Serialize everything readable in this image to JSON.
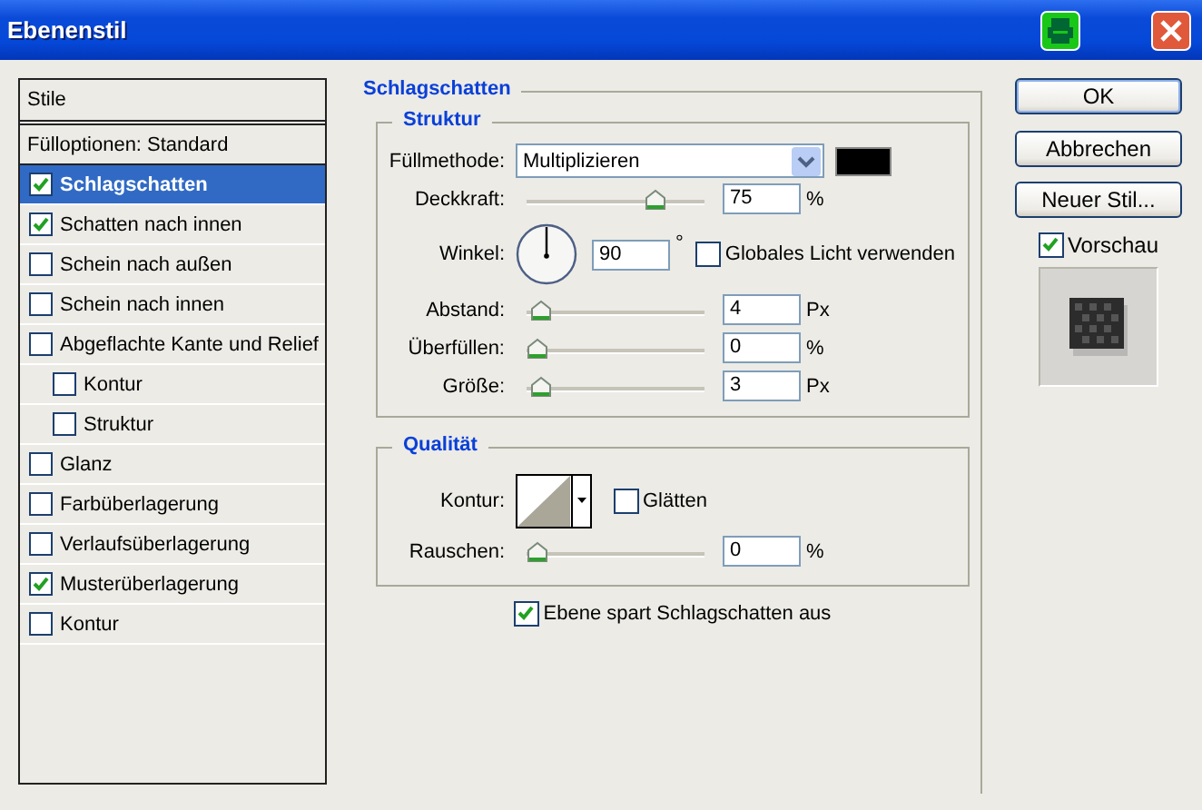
{
  "window": {
    "title": "Ebenenstil"
  },
  "styles_panel": {
    "header": "Stile",
    "items": [
      {
        "kind": "plain",
        "label": "Fülloptionen: Standard",
        "selected": false
      },
      {
        "kind": "check",
        "label": "Schlagschatten",
        "checked": true,
        "selected": true
      },
      {
        "kind": "check",
        "label": "Schatten nach innen",
        "checked": true,
        "selected": false
      },
      {
        "kind": "check",
        "label": "Schein nach außen",
        "checked": false,
        "selected": false
      },
      {
        "kind": "check",
        "label": "Schein nach innen",
        "checked": false,
        "selected": false
      },
      {
        "kind": "check",
        "label": "Abgeflachte Kante und Relief",
        "checked": false,
        "selected": false,
        "children": [
          {
            "label": "Kontur",
            "checked": false,
            "selected": false
          },
          {
            "label": "Struktur",
            "checked": false,
            "selected": false
          }
        ]
      },
      {
        "kind": "check",
        "label": "Glanz",
        "checked": false,
        "selected": false
      },
      {
        "kind": "check",
        "label": "Farbüberlagerung",
        "checked": false,
        "selected": false
      },
      {
        "kind": "check",
        "label": "Verlaufsüberlagerung",
        "checked": false,
        "selected": false
      },
      {
        "kind": "check",
        "label": "Musterüberlagerung",
        "checked": true,
        "selected": false
      },
      {
        "kind": "check",
        "label": "Kontur",
        "checked": false,
        "selected": false
      }
    ]
  },
  "section": {
    "title": "Schlagschatten",
    "structure": {
      "title": "Struktur",
      "blend_mode": {
        "label": "Füllmethode:",
        "value": "Multiplizieren",
        "color": "#000000"
      },
      "rows": [
        {
          "kind": "slider",
          "label": "Deckkraft:",
          "level": 0.75,
          "value": "75",
          "unit": "%"
        },
        {
          "kind": "angle",
          "label": "Winkel:",
          "value": "90",
          "unit": "°",
          "global_light": {
            "label": "Globales Licht verwenden",
            "checked": false
          }
        },
        {
          "kind": "slider",
          "label": "Abstand:",
          "level": 0.02,
          "value": "4",
          "unit": "Px"
        },
        {
          "kind": "slider",
          "label": "Überfüllen:",
          "level": 0,
          "value": "0",
          "unit": "%"
        },
        {
          "kind": "slider",
          "label": "Größe:",
          "level": 0.02,
          "value": "3",
          "unit": "Px"
        }
      ]
    },
    "quality": {
      "title": "Qualität",
      "contour": {
        "label": "Kontur:"
      },
      "antialias": {
        "label": "Glätten",
        "checked": false
      },
      "noise": {
        "label": "Rauschen:",
        "level": 0,
        "value": "0",
        "unit": "%"
      }
    },
    "knockout": {
      "label": "Ebene spart Schlagschatten aus",
      "checked": true
    }
  },
  "buttons": [
    {
      "label": "OK",
      "default": true
    },
    {
      "label": "Abbrechen",
      "default": false
    },
    {
      "label": "Neuer Stil...",
      "default": false
    }
  ],
  "preview": {
    "label": "Vorschau",
    "checked": true
  }
}
